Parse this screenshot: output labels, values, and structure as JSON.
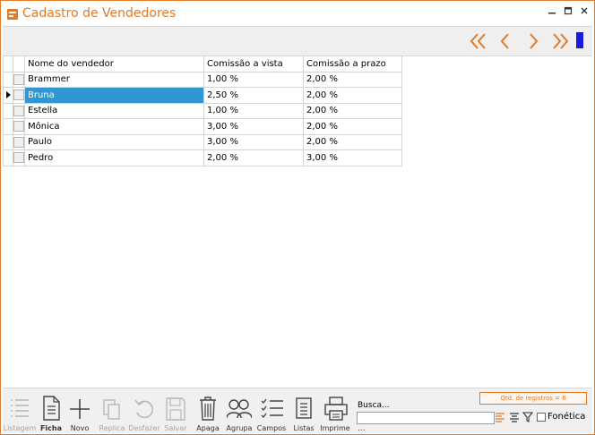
{
  "window": {
    "title": "Cadastro de Vendedores",
    "controls": [
      "minimize",
      "maximize",
      "close"
    ]
  },
  "nav": {
    "buttons": [
      "first-icon",
      "previous-icon",
      "next-icon",
      "last-icon"
    ],
    "accent": "#e07b29"
  },
  "grid": {
    "columns": [
      "Nome do vendedor",
      "Comissão a vista",
      "Comissão a prazo"
    ],
    "rows": [
      {
        "nome": "Brammer",
        "vista": "1,00 %",
        "prazo": "2,00 %"
      },
      {
        "nome": "Bruna",
        "vista": "2,50 %",
        "prazo": "2,00 %"
      },
      {
        "nome": "Estella",
        "vista": "1,00 %",
        "prazo": "2,00 %"
      },
      {
        "nome": "Mônica",
        "vista": "3,00 %",
        "prazo": "2,00 %"
      },
      {
        "nome": "Paulo",
        "vista": "3,00 %",
        "prazo": "2,00 %"
      },
      {
        "nome": "Pedro",
        "vista": "2,00 %",
        "prazo": "3,00 %"
      }
    ],
    "selected_row": 1,
    "selection_color": "#3097d1"
  },
  "toolbar": {
    "listagem": "Listagem",
    "ficha": "Ficha",
    "novo": "Novo",
    "replica": "Replica",
    "desfazer": "Desfazer",
    "salvar": "Salvar",
    "apaga": "Apaga",
    "agrupa": "Agrupa",
    "campos": "Campos",
    "listas": "Listas",
    "imprime": "Imprime"
  },
  "search": {
    "label": "Busca...",
    "value": "",
    "dots": "...",
    "count": "Qtd. de registros = 6",
    "fonetica": "Fonética",
    "fonetica_checked": false
  }
}
